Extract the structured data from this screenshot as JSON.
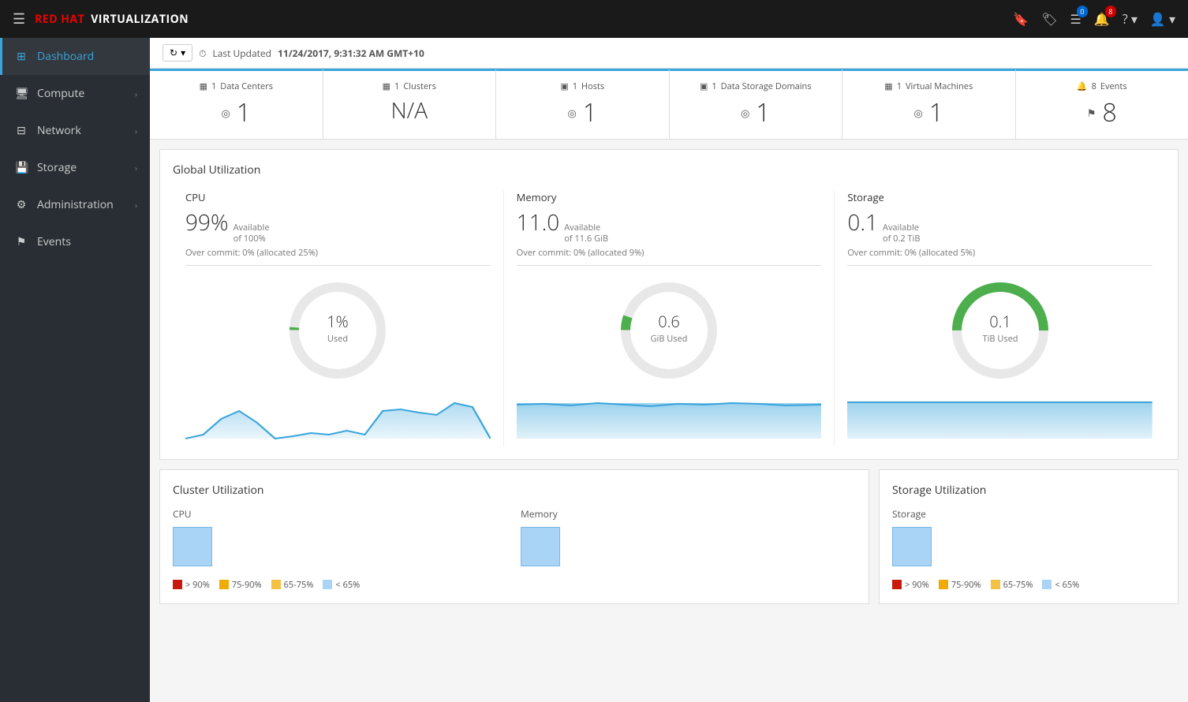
{
  "topbar": {
    "menu_icon": "☰",
    "logo_red": "RED HAT",
    "logo_product": "VIRTUALIZATION",
    "icons": {
      "bookmark": "🔖",
      "tag": "🏷",
      "list": "☰",
      "bell": "🔔",
      "help": "?",
      "user": "👤"
    },
    "badge_list": "0",
    "badge_bell": "8"
  },
  "sidebar": {
    "items": [
      {
        "id": "dashboard",
        "label": "Dashboard",
        "icon": "⊞",
        "active": true,
        "hasChevron": false
      },
      {
        "id": "compute",
        "label": "Compute",
        "icon": "⬜",
        "active": false,
        "hasChevron": true
      },
      {
        "id": "network",
        "label": "Network",
        "icon": "⊟",
        "active": false,
        "hasChevron": true
      },
      {
        "id": "storage",
        "label": "Storage",
        "icon": "⊕",
        "active": false,
        "hasChevron": true
      },
      {
        "id": "administration",
        "label": "Administration",
        "icon": "⚙",
        "active": false,
        "hasChevron": true
      },
      {
        "id": "events",
        "label": "Events",
        "icon": "⚑",
        "active": false,
        "hasChevron": false
      }
    ]
  },
  "subheader": {
    "refresh_label": "↻",
    "dropdown_label": "▾",
    "clock_icon": "⏱",
    "last_updated_label": "Last Updated",
    "last_updated_value": "11/24/2017, 9:31:32 AM GMT+10"
  },
  "summary_cards": [
    {
      "id": "data-centers",
      "icon": "▦",
      "count": "1",
      "label": "Data Centers",
      "status_icon": "◎",
      "value": "1",
      "value_na": false
    },
    {
      "id": "clusters",
      "icon": "▦",
      "count": "1",
      "label": "Clusters",
      "status_icon": "◎",
      "value": "N/A",
      "value_na": true
    },
    {
      "id": "hosts",
      "icon": "▣",
      "count": "1",
      "label": "Hosts",
      "status_icon": "◎",
      "value": "1",
      "value_na": false
    },
    {
      "id": "data-storage",
      "icon": "▣",
      "count": "1",
      "label": "Data Storage Domains",
      "status_icon": "◎",
      "value": "1",
      "value_na": false
    },
    {
      "id": "virtual-machines",
      "icon": "▦",
      "count": "1",
      "label": "Virtual Machines",
      "status_icon": "◎",
      "value": "1",
      "value_na": false
    },
    {
      "id": "events",
      "icon": "🔔",
      "count": "8",
      "label": "Events",
      "status_icon": "⚑",
      "value": "8",
      "value_na": false
    }
  ],
  "global_utilization": {
    "title": "Global Utilization",
    "panels": [
      {
        "id": "cpu",
        "title": "CPU",
        "big_value": "99%",
        "available_label": "Available",
        "available_of": "of 100%",
        "overcommit": "Over commit: 0% (allocated 25%)",
        "donut_value": "1%",
        "donut_sub": "Used",
        "donut_percent": 1,
        "donut_color": "#4cae4c"
      },
      {
        "id": "memory",
        "title": "Memory",
        "big_value": "11.0",
        "available_label": "Available",
        "available_of": "of 11.6 GiB",
        "overcommit": "Over commit: 0% (allocated 9%)",
        "donut_value": "0.6",
        "donut_sub": "GiB Used",
        "donut_percent": 5,
        "donut_color": "#4cae4c"
      },
      {
        "id": "storage",
        "title": "Storage",
        "big_value": "0.1",
        "available_label": "Available",
        "available_of": "of 0.2 TiB",
        "overcommit": "Over commit: 0% (allocated 5%)",
        "donut_value": "0.1",
        "donut_sub": "TiB Used",
        "donut_percent": 50,
        "donut_color": "#4cae4c"
      }
    ]
  },
  "cluster_utilization": {
    "title": "Cluster Utilization",
    "cpu_label": "CPU",
    "memory_label": "Memory",
    "legend": [
      {
        "color": "#c9190b",
        "label": "> 90%"
      },
      {
        "color": "#f0ab00",
        "label": "75-90%"
      },
      {
        "color": "#f4c145",
        "label": "65-75%"
      },
      {
        "color": "#aad4f5",
        "label": "< 65%"
      }
    ]
  },
  "storage_utilization": {
    "title": "Storage Utilization",
    "storage_label": "Storage",
    "legend": [
      {
        "color": "#c9190b",
        "label": "> 90%"
      },
      {
        "color": "#f0ab00",
        "label": "75-90%"
      },
      {
        "color": "#f4c145",
        "label": "65-75%"
      },
      {
        "color": "#aad4f5",
        "label": "< 65%"
      }
    ]
  }
}
